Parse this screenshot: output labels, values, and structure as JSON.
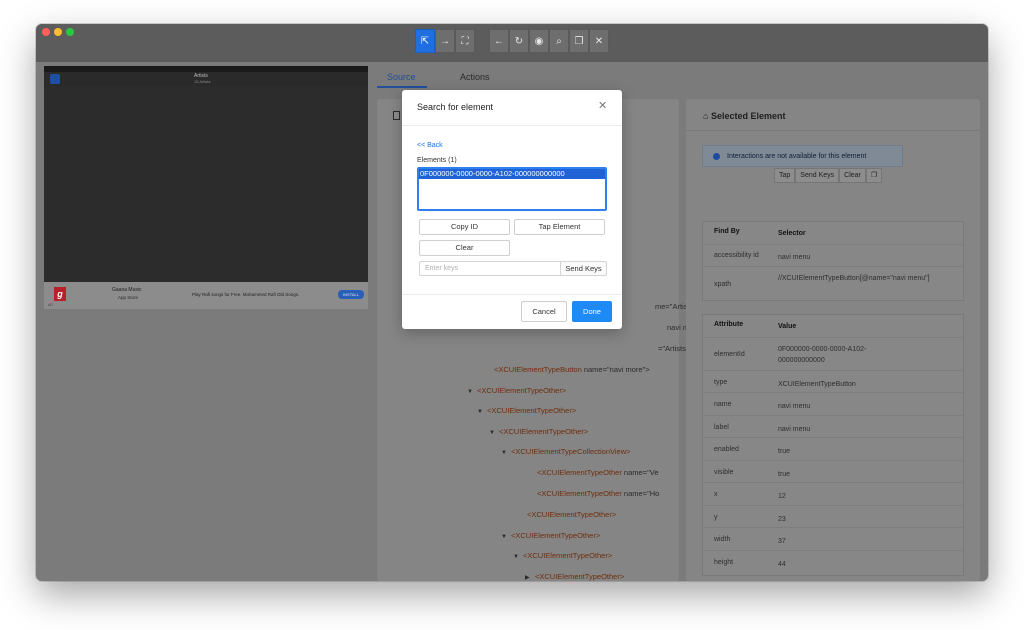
{
  "toolbar": {
    "buttons": [
      {
        "icon": "select-icon",
        "glyph": "⇱",
        "active": true
      },
      {
        "icon": "swipe-icon",
        "glyph": "→",
        "active": false
      },
      {
        "icon": "tap-by-coordinates-icon",
        "glyph": "⛶",
        "active": false
      },
      {
        "icon": "back-icon",
        "glyph": "←",
        "active": false
      },
      {
        "icon": "refresh-icon",
        "glyph": "↻",
        "active": false
      },
      {
        "icon": "eye-icon",
        "glyph": "◉",
        "active": false
      },
      {
        "icon": "search-icon",
        "glyph": "⌕",
        "active": false
      },
      {
        "icon": "copy-icon",
        "glyph": "❐",
        "active": false
      },
      {
        "icon": "close-icon",
        "glyph": "✕",
        "active": false
      }
    ]
  },
  "device": {
    "nav_title": "Artists",
    "nav_subtitle": "15 Artists",
    "ad": {
      "logo": "g",
      "app_name": "Gaana Music",
      "store": "App Store",
      "text": "Play Rafi songs for Free. Mohammed Rafi Old Songs.",
      "button": "INSTALL",
      "tag": "AD"
    }
  },
  "tabs": {
    "source": "Source",
    "actions": "Actions"
  },
  "source_tree": [
    {
      "caret": "",
      "tag": "",
      "attr": "me=\"Artists\""
    },
    {
      "caret": "",
      "tag": "",
      "attr": "navi menu\""
    },
    {
      "caret": "",
      "tag": "",
      "attr": "=\"Artists\">"
    },
    {
      "caret": "",
      "tag": "<XCUIElementTypeButton ",
      "attr": "name=\"navi more\">"
    },
    {
      "caret": "▼",
      "tag": "<XCUIElementTypeOther>",
      "attr": ""
    },
    {
      "caret": "▼",
      "tag": "<XCUIElementTypeOther>",
      "attr": ""
    },
    {
      "caret": "▼",
      "tag": "<XCUIElementTypeOther>",
      "attr": ""
    },
    {
      "caret": "▼",
      "tag": "<XCUIElementTypeCollectionView>",
      "attr": ""
    },
    {
      "caret": "",
      "tag": "<XCUIElementTypeOther ",
      "attr": "name=\"Ve"
    },
    {
      "caret": "",
      "tag": "<XCUIElementTypeOther ",
      "attr": "name=\"Ho"
    },
    {
      "caret": "",
      "tag": "<XCUIElementTypeOther>",
      "attr": ""
    },
    {
      "caret": "▼",
      "tag": "<XCUIElementTypeOther>",
      "attr": ""
    },
    {
      "caret": "▼",
      "tag": "<XCUIElementTypeOther>",
      "attr": ""
    },
    {
      "caret": "▶",
      "tag": "<XCUIElementTypeOther>",
      "attr": ""
    },
    {
      "caret": "▼",
      "tag": "<XCUIElementTypeWindow>",
      "attr": ""
    }
  ],
  "selected": {
    "title": "Selected Element",
    "banner": "Interactions are not available for this element",
    "actions": [
      "Tap",
      "Send Keys",
      "Clear"
    ],
    "copy_icon": "copy-icon",
    "find_by_header": [
      "Find By",
      "Selector"
    ],
    "find_by": [
      [
        "accessibility id",
        "navi menu"
      ],
      [
        "xpath",
        "//XCUIElementTypeButton[@name=\"navi menu\"]"
      ]
    ],
    "attr_header": [
      "Attribute",
      "Value"
    ],
    "attributes": [
      [
        "elementId",
        "0F000000-0000-0000-A102-000000000000"
      ],
      [
        "type",
        "XCUIElementTypeButton"
      ],
      [
        "name",
        "navi menu"
      ],
      [
        "label",
        "navi menu"
      ],
      [
        "enabled",
        "true"
      ],
      [
        "visible",
        "true"
      ],
      [
        "x",
        "12"
      ],
      [
        "y",
        "23"
      ],
      [
        "width",
        "37"
      ],
      [
        "height",
        "44"
      ]
    ]
  },
  "modal": {
    "title": "Search for element",
    "back": "<< Back",
    "elements_label": "Elements (1)",
    "elements": [
      "0F000000-0000-0000-A102-000000000000"
    ],
    "copy_id": "Copy ID",
    "tap_element": "Tap Element",
    "clear": "Clear",
    "keys_placeholder": "Enter keys",
    "send_keys": "Send Keys",
    "cancel": "Cancel",
    "done": "Done"
  }
}
